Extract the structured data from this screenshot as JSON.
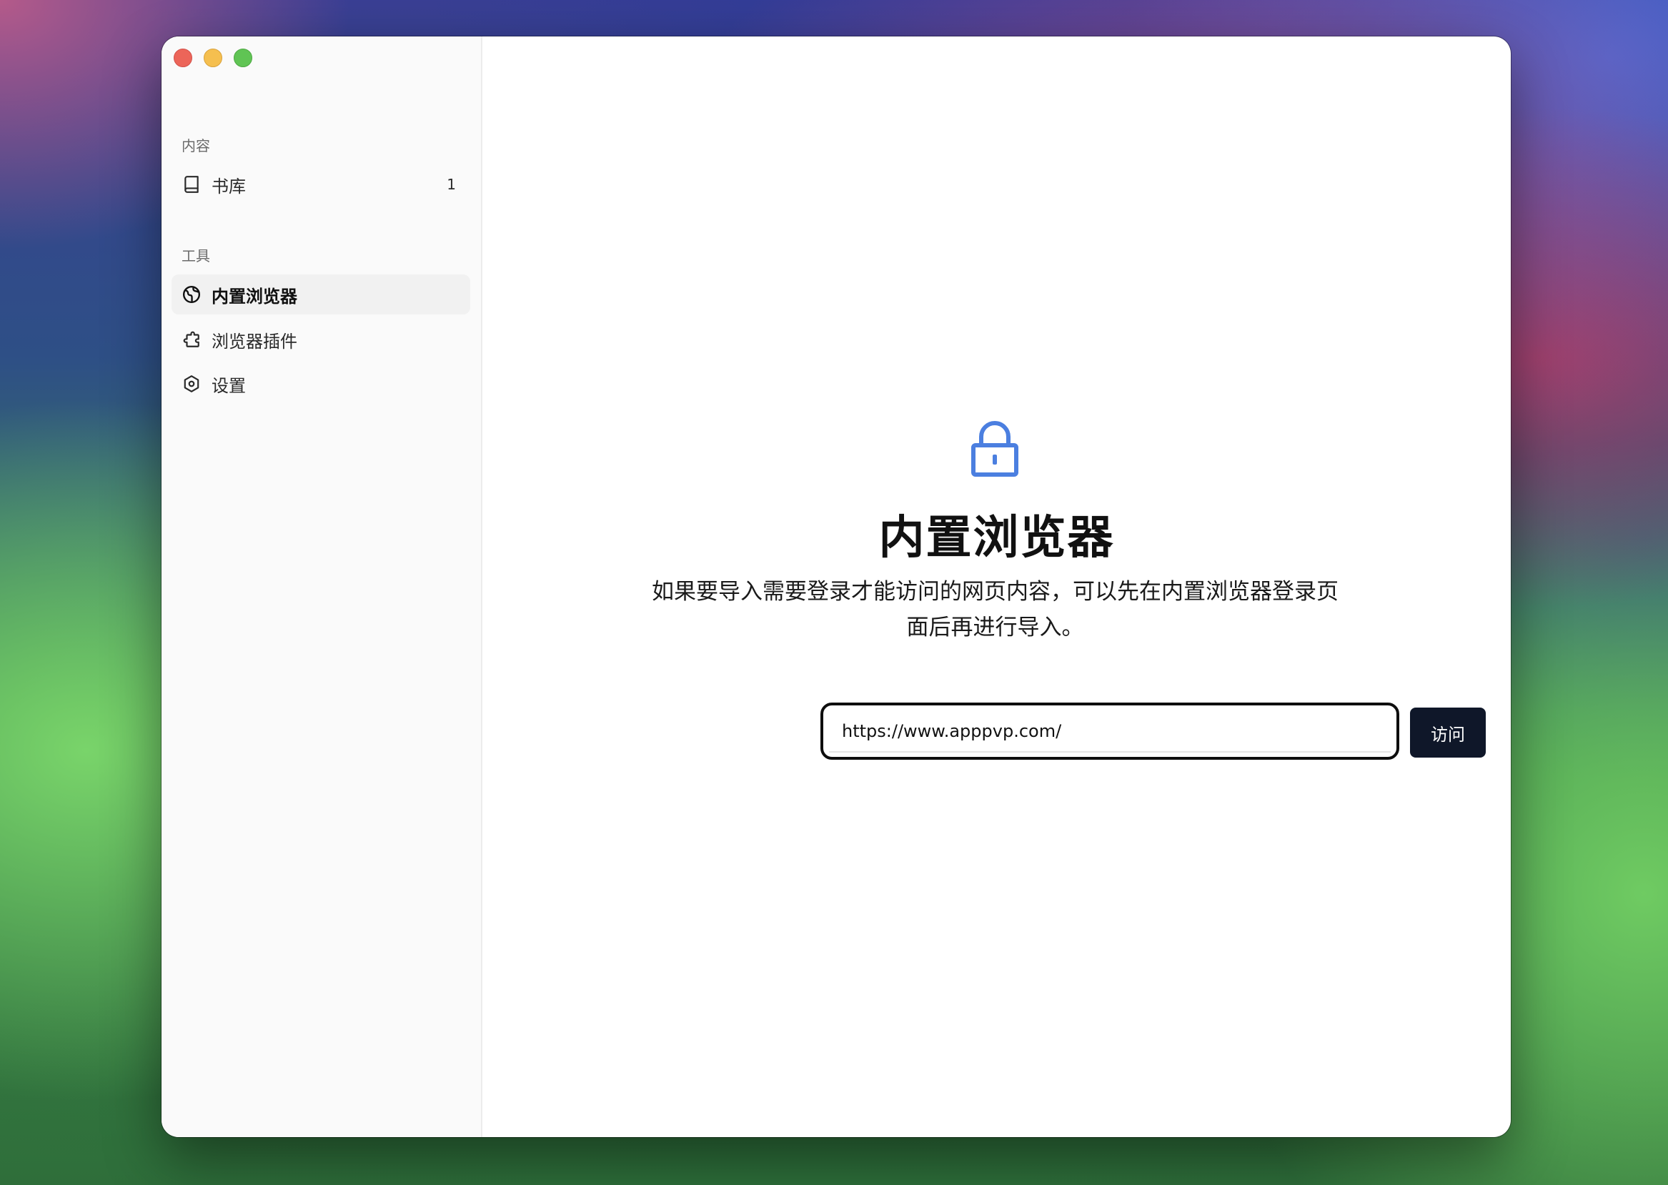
{
  "colors": {
    "accent": "#4b7fe0",
    "button_bg": "#0f1729",
    "sidebar_bg": "#fafafa"
  },
  "sidebar": {
    "sections": [
      {
        "title": "内容",
        "items": [
          {
            "label": "书库",
            "icon": "book-icon",
            "badge": "1"
          }
        ]
      },
      {
        "title": "工具",
        "items": [
          {
            "label": "内置浏览器",
            "icon": "globe-icon",
            "active": true
          },
          {
            "label": "浏览器插件",
            "icon": "puzzle-icon"
          },
          {
            "label": "设置",
            "icon": "gear-icon"
          }
        ]
      }
    ]
  },
  "main": {
    "icon": "lock-icon",
    "title": "内置浏览器",
    "description_line1": "如果要导入需要登录才能访问的网页内容，可以先在内置浏览器登录页",
    "description_line2": "面后再进行导入。",
    "url_input": {
      "value": "https://www.apppvp.com/"
    },
    "visit_label": "访问"
  }
}
